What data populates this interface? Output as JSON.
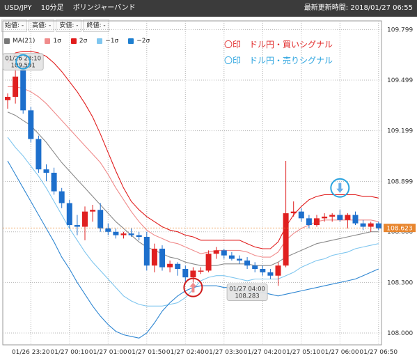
{
  "header": {
    "symbol": "USD/JPY",
    "timeframe": "10分足",
    "indicator_name": "ボリンジャーバンド",
    "last_updated": "最新更新時間: 2018/01/27 06:55"
  },
  "ohlc": {
    "open": "始値: -",
    "high": "高値: -",
    "low": "安値: -",
    "close": "終値: -"
  },
  "legend": [
    {
      "label": "MA(21)",
      "color": "#777777"
    },
    {
      "label": "1σ",
      "color": "#f08b8b"
    },
    {
      "label": "2σ",
      "color": "#e11c1c"
    },
    {
      "label": "−1σ",
      "color": "#7fc6ef"
    },
    {
      "label": "−2σ",
      "color": "#1e7fd0"
    }
  ],
  "signals": {
    "buy_text": "〇印　ドル円・買いシグナル",
    "sell_text": "〇印　ドル円・売りシグナル"
  },
  "colors": {
    "up": "#e02020",
    "down": "#1d6fcc",
    "ma": "#8a8a8a",
    "plus1": "#f08b8b",
    "plus2": "#e11c1c",
    "minus1": "#7fc6ef",
    "minus2": "#2e86d2",
    "price_tag": "#e8862f"
  },
  "chart_data": {
    "type": "candlestick",
    "title": "USD/JPY 10分足 ボリンジャーバンド",
    "ylim": [
      107.93,
      109.85
    ],
    "y_ticks": [
      "109.799",
      "109.499",
      "109.199",
      "108.899",
      "108.600",
      "108.300",
      "108.000"
    ],
    "x_ticks": [
      "01/26 23:20",
      "01/27 00:10",
      "01/27 01:00",
      "01/27 01:50",
      "01/27 02:40",
      "01/27 03:30",
      "01/27 04:20",
      "01/27 05:10",
      "01/27 06:00",
      "01/27 06:50"
    ],
    "current_price": "108.623",
    "annotations": [
      {
        "text": "01/26 23:10\n109.591",
        "index": 2,
        "price": 109.591
      },
      {
        "text": "01/27 04:00\n108.283",
        "index": 31,
        "price": 108.283
      }
    ],
    "buy_signal": {
      "index": 24,
      "price": 108.27
    },
    "sell_signal": {
      "index": 43,
      "price": 108.86
    },
    "candles": [
      {
        "o": 109.38,
        "h": 109.42,
        "l": 109.33,
        "c": 109.4
      },
      {
        "o": 109.4,
        "h": 109.58,
        "l": 109.36,
        "c": 109.52
      },
      {
        "o": 109.59,
        "h": 109.59,
        "l": 109.3,
        "c": 109.32
      },
      {
        "o": 109.32,
        "h": 109.34,
        "l": 109.13,
        "c": 109.15
      },
      {
        "o": 109.15,
        "h": 109.17,
        "l": 108.95,
        "c": 108.97
      },
      {
        "o": 108.97,
        "h": 109.0,
        "l": 108.9,
        "c": 108.95
      },
      {
        "o": 108.95,
        "h": 108.98,
        "l": 108.82,
        "c": 108.84
      },
      {
        "o": 108.84,
        "h": 108.86,
        "l": 108.74,
        "c": 108.77
      },
      {
        "o": 108.77,
        "h": 108.79,
        "l": 108.62,
        "c": 108.64
      },
      {
        "o": 108.64,
        "h": 108.7,
        "l": 108.58,
        "c": 108.63
      },
      {
        "o": 108.63,
        "h": 108.75,
        "l": 108.55,
        "c": 108.72
      },
      {
        "o": 108.72,
        "h": 108.76,
        "l": 108.66,
        "c": 108.73
      },
      {
        "o": 108.73,
        "h": 108.77,
        "l": 108.6,
        "c": 108.62
      },
      {
        "o": 108.62,
        "h": 108.65,
        "l": 108.58,
        "c": 108.6
      },
      {
        "o": 108.6,
        "h": 108.62,
        "l": 108.56,
        "c": 108.58
      },
      {
        "o": 108.58,
        "h": 108.6,
        "l": 108.56,
        "c": 108.59
      },
      {
        "o": 108.59,
        "h": 108.62,
        "l": 108.57,
        "c": 108.58
      },
      {
        "o": 108.58,
        "h": 108.6,
        "l": 108.55,
        "c": 108.57
      },
      {
        "o": 108.57,
        "h": 108.6,
        "l": 108.37,
        "c": 108.4
      },
      {
        "o": 108.4,
        "h": 108.53,
        "l": 108.36,
        "c": 108.5
      },
      {
        "o": 108.5,
        "h": 108.52,
        "l": 108.37,
        "c": 108.39
      },
      {
        "o": 108.39,
        "h": 108.43,
        "l": 108.36,
        "c": 108.41
      },
      {
        "o": 108.41,
        "h": 108.42,
        "l": 108.34,
        "c": 108.38
      },
      {
        "o": 108.38,
        "h": 108.4,
        "l": 108.3,
        "c": 108.33
      },
      {
        "o": 108.33,
        "h": 108.39,
        "l": 108.3,
        "c": 108.37
      },
      {
        "o": 108.37,
        "h": 108.39,
        "l": 108.35,
        "c": 108.37
      },
      {
        "o": 108.37,
        "h": 108.49,
        "l": 108.36,
        "c": 108.47
      },
      {
        "o": 108.47,
        "h": 108.51,
        "l": 108.44,
        "c": 108.49
      },
      {
        "o": 108.49,
        "h": 108.5,
        "l": 108.44,
        "c": 108.46
      },
      {
        "o": 108.46,
        "h": 108.48,
        "l": 108.43,
        "c": 108.44
      },
      {
        "o": 108.44,
        "h": 108.46,
        "l": 108.41,
        "c": 108.43
      },
      {
        "o": 108.43,
        "h": 108.45,
        "l": 108.38,
        "c": 108.4
      },
      {
        "o": 108.4,
        "h": 108.42,
        "l": 108.36,
        "c": 108.38
      },
      {
        "o": 108.38,
        "h": 108.4,
        "l": 108.34,
        "c": 108.36
      },
      {
        "o": 108.36,
        "h": 108.38,
        "l": 108.32,
        "c": 108.34
      },
      {
        "o": 108.34,
        "h": 108.42,
        "l": 108.28,
        "c": 108.4
      },
      {
        "o": 108.4,
        "h": 109.02,
        "l": 108.39,
        "c": 108.71
      },
      {
        "o": 108.71,
        "h": 108.78,
        "l": 108.69,
        "c": 108.72
      },
      {
        "o": 108.72,
        "h": 108.74,
        "l": 108.66,
        "c": 108.68
      },
      {
        "o": 108.68,
        "h": 108.7,
        "l": 108.62,
        "c": 108.64
      },
      {
        "o": 108.64,
        "h": 108.7,
        "l": 108.63,
        "c": 108.68
      },
      {
        "o": 108.68,
        "h": 108.71,
        "l": 108.66,
        "c": 108.69
      },
      {
        "o": 108.69,
        "h": 108.71,
        "l": 108.66,
        "c": 108.7
      },
      {
        "o": 108.7,
        "h": 108.73,
        "l": 108.66,
        "c": 108.67
      },
      {
        "o": 108.67,
        "h": 108.71,
        "l": 108.62,
        "c": 108.7
      },
      {
        "o": 108.7,
        "h": 108.72,
        "l": 108.64,
        "c": 108.65
      },
      {
        "o": 108.65,
        "h": 108.67,
        "l": 108.61,
        "c": 108.63
      },
      {
        "o": 108.63,
        "h": 108.66,
        "l": 108.6,
        "c": 108.65
      },
      {
        "o": 108.65,
        "h": 108.66,
        "l": 108.61,
        "c": 108.62
      }
    ],
    "bands": {
      "ma": [
        109.31,
        109.29,
        109.26,
        109.23,
        109.18,
        109.13,
        109.07,
        109.01,
        108.96,
        108.91,
        108.86,
        108.81,
        108.76,
        108.71,
        108.66,
        108.62,
        108.58,
        108.54,
        108.51,
        108.49,
        108.47,
        108.45,
        108.44,
        108.42,
        108.41,
        108.4,
        108.4,
        108.4,
        108.41,
        108.41,
        108.41,
        108.41,
        108.4,
        108.4,
        108.4,
        108.42,
        108.45,
        108.47,
        108.49,
        108.51,
        108.53,
        108.54,
        108.55,
        108.56,
        108.57,
        108.58,
        108.59,
        108.6,
        108.6
      ],
      "plus1": [
        109.46,
        109.46,
        109.45,
        109.43,
        109.4,
        109.36,
        109.31,
        109.26,
        109.21,
        109.16,
        109.11,
        109.06,
        109.01,
        108.94,
        108.86,
        108.79,
        108.72,
        108.66,
        108.61,
        108.58,
        108.56,
        108.54,
        108.53,
        108.51,
        108.49,
        108.47,
        108.48,
        108.49,
        108.49,
        108.49,
        108.49,
        108.48,
        108.46,
        108.45,
        108.45,
        108.48,
        108.55,
        108.59,
        108.62,
        108.64,
        108.66,
        108.67,
        108.67,
        108.67,
        108.67,
        108.67,
        108.67,
        108.67,
        108.66
      ],
      "plus2": [
        109.6,
        109.66,
        109.67,
        109.67,
        109.66,
        109.64,
        109.6,
        109.55,
        109.49,
        109.43,
        109.36,
        109.28,
        109.18,
        109.07,
        108.96,
        108.86,
        108.78,
        108.73,
        108.69,
        108.66,
        108.63,
        108.61,
        108.6,
        108.58,
        108.57,
        108.55,
        108.55,
        108.55,
        108.55,
        108.55,
        108.55,
        108.53,
        108.51,
        108.5,
        108.5,
        108.54,
        108.63,
        108.7,
        108.75,
        108.79,
        108.81,
        108.82,
        108.82,
        108.82,
        108.82,
        108.82,
        108.81,
        108.81,
        108.8
      ],
      "minus1": [
        109.16,
        109.1,
        109.05,
        108.99,
        108.93,
        108.86,
        108.78,
        108.7,
        108.62,
        108.55,
        108.48,
        108.42,
        108.37,
        108.32,
        108.27,
        108.22,
        108.19,
        108.17,
        108.16,
        108.16,
        108.16,
        108.17,
        108.18,
        108.21,
        108.26,
        108.31,
        108.33,
        108.34,
        108.34,
        108.33,
        108.32,
        108.31,
        108.32,
        108.32,
        108.32,
        108.32,
        108.34,
        108.36,
        108.39,
        108.41,
        108.43,
        108.44,
        108.46,
        108.47,
        108.48,
        108.5,
        108.51,
        108.52,
        108.53
      ],
      "minus2": [
        109.02,
        108.94,
        108.86,
        108.78,
        108.7,
        108.62,
        108.54,
        108.45,
        108.38,
        108.3,
        108.23,
        108.16,
        108.1,
        108.05,
        108.01,
        107.99,
        107.98,
        107.97,
        108.0,
        108.06,
        108.13,
        108.18,
        108.22,
        108.25,
        108.27,
        108.28,
        108.28,
        108.28,
        108.27,
        108.27,
        108.26,
        108.25,
        108.24,
        108.24,
        108.23,
        108.22,
        108.23,
        108.24,
        108.25,
        108.26,
        108.27,
        108.28,
        108.29,
        108.3,
        108.31,
        108.32,
        108.34,
        108.36,
        108.38
      ]
    }
  }
}
